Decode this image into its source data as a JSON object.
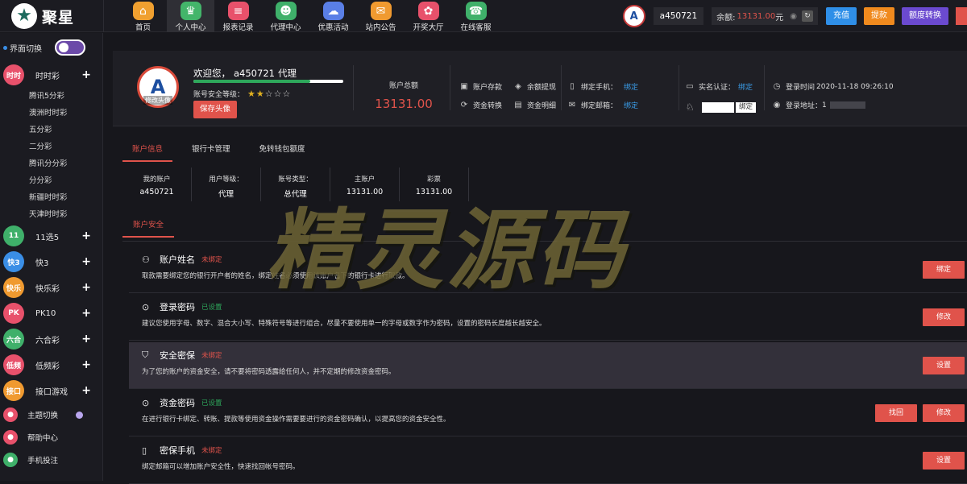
{
  "logo": {
    "text": "聚星"
  },
  "nav": [
    {
      "label": "首页",
      "icon": "home-icon",
      "color": "#f0a030",
      "glyph": "⌂"
    },
    {
      "label": "个人中心",
      "icon": "crown-icon",
      "color": "#43b56a",
      "glyph": "♛",
      "active": true
    },
    {
      "label": "报表记录",
      "icon": "report-icon",
      "color": "#e8516b",
      "glyph": "≡"
    },
    {
      "label": "代理中心",
      "icon": "agent-icon",
      "color": "#3fb06a",
      "glyph": "☻"
    },
    {
      "label": "优惠活动",
      "icon": "gift-icon",
      "color": "#5a7fe6",
      "glyph": "☁"
    },
    {
      "label": "站内公告",
      "icon": "mail-icon",
      "color": "#f09a30",
      "glyph": "✉"
    },
    {
      "label": "开奖大厅",
      "icon": "lottery-icon",
      "color": "#e8516b",
      "glyph": "✿"
    },
    {
      "label": "在线客服",
      "icon": "support-icon",
      "color": "#3fb06a",
      "glyph": "☎"
    }
  ],
  "top": {
    "username": "a450721",
    "balance_label": "余额:",
    "balance_value": "13131.00",
    "balance_unit": "元",
    "buttons": [
      {
        "label": "充值",
        "color": "#2f8fe8"
      },
      {
        "label": "提款",
        "color": "#f08a1e"
      },
      {
        "label": "额度转换",
        "color": "#6b4ad0"
      }
    ]
  },
  "sidebar": {
    "switch_label": "界面切换",
    "categories": [
      {
        "label": "时时彩",
        "badge": "时时",
        "color": "#e8516b",
        "subs": [
          "腾讯5分彩",
          "澳洲时时彩",
          "五分彩",
          "二分彩",
          "腾讯分分彩",
          "分分彩",
          "新疆时时彩",
          "天津时时彩"
        ]
      },
      {
        "label": "11选5",
        "badge": "11",
        "color": "#3fb06a"
      },
      {
        "label": "快3",
        "badge": "快3",
        "color": "#3a8ee6"
      },
      {
        "label": "快乐彩",
        "badge": "快乐",
        "color": "#f09a30"
      },
      {
        "label": "PK10",
        "badge": "PK",
        "color": "#e8516b"
      },
      {
        "label": "六合彩",
        "badge": "六合",
        "color": "#3fb06a"
      },
      {
        "label": "低频彩",
        "badge": "低频",
        "color": "#e8516b"
      },
      {
        "label": "接口游戏",
        "badge": "接口",
        "color": "#f09a30"
      }
    ],
    "bottom": [
      {
        "label": "主题切换",
        "icon": "theme-icon",
        "color": "#e8516b"
      },
      {
        "label": "帮助中心",
        "icon": "help-icon",
        "color": "#e8516b"
      },
      {
        "label": "手机投注",
        "icon": "mobile-icon",
        "color": "#3fb06a"
      }
    ]
  },
  "profile": {
    "welcome_prefix": "欢迎您，",
    "username": "a450721",
    "role": "代理",
    "security_label": "账号安全等级：",
    "security_level": 0.78,
    "stars_on": 2,
    "stars_total": 5,
    "avatar_caption": "修改头像",
    "save_avatar": "保存头像",
    "total_label": "账户总额",
    "total_value": "13131.00",
    "links": [
      {
        "icon": "deposit-icon",
        "label": "账户存款"
      },
      {
        "icon": "withdraw-icon",
        "label": "余额提现"
      },
      {
        "icon": "transfer-icon",
        "label": "资金转换"
      },
      {
        "icon": "detail-icon",
        "label": "资金明细"
      }
    ],
    "bind_phone_label": "绑定手机：",
    "bind_email_label": "绑定邮箱：",
    "bind_link": "绑定",
    "real_name_label": "实名认证：",
    "real_name_link": "绑定",
    "qq_bind": "绑定",
    "login_time_label": "登录时间",
    "login_time": "2020-11-18 09:26:10",
    "login_addr_label": "登录地址：",
    "login_addr": "1"
  },
  "tabs": [
    "账户信息",
    "银行卡管理",
    "免转钱包额度"
  ],
  "info_table": [
    {
      "h": "我的账户",
      "v": "a450721"
    },
    {
      "h": "用户等级：",
      "v": "代理"
    },
    {
      "h": "账号类型：",
      "v": "总代理"
    },
    {
      "h": "主账户",
      "v": "13131.00"
    },
    {
      "h": "彩票",
      "v": "13131.00"
    }
  ],
  "security_tab": "账户安全",
  "security_items": [
    {
      "title": "账户姓名",
      "status": "未绑定",
      "status_type": "red",
      "icon": "user-icon",
      "desc": "取款需要绑定您的银行开户者的姓名，绑定姓名必须使用该账户名下的银行卡进行取款。",
      "actions": [
        "绑定"
      ]
    },
    {
      "title": "登录密码",
      "status": "已设置",
      "status_type": "green",
      "icon": "lock-icon",
      "desc": "建议您使用字母、数字、混合大小写、特殊符号等进行组合，尽量不要使用单一的字母或数字作为密码，设置的密码长度越长越安全。",
      "actions": [
        "修改"
      ]
    },
    {
      "title": "安全密保",
      "status": "未绑定",
      "status_type": "red",
      "icon": "shield-icon",
      "desc": "为了您的账户的资金安全，请不要将密码透露给任何人，并不定期的修改资金密码。",
      "actions": [
        "设置"
      ]
    },
    {
      "title": "资金密码",
      "status": "已设置",
      "status_type": "green",
      "icon": "lock-icon",
      "desc": "在进行银行卡绑定、转账、提款等使用资金操作需要要进行的资金密码确认，以提高您的资金安全性。",
      "actions": [
        "找回",
        "修改"
      ]
    },
    {
      "title": "密保手机",
      "status": "未绑定",
      "status_type": "red",
      "icon": "phone-icon",
      "desc": "绑定邮箱可以增加账户安全性，快速找回帐号密码。",
      "actions": [
        "设置"
      ]
    }
  ],
  "watermark": "精灵源码"
}
